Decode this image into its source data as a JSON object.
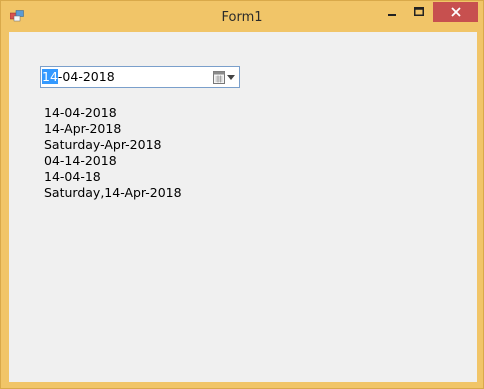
{
  "window": {
    "title": "Form1",
    "controls": {
      "minimize": "minimize-icon",
      "maximize": "maximize-icon",
      "close": "close-icon"
    }
  },
  "datetimepicker": {
    "day": "14",
    "rest": "-04-2018",
    "icon": "calendar-icon"
  },
  "labels": [
    "14-04-2018",
    "14-Apr-2018",
    "Saturday-Apr-2018",
    "04-14-2018",
    "14-04-18",
    "Saturday,14-Apr-2018"
  ],
  "colors": {
    "title_bar": "#f1c568",
    "close_button": "#c7504f",
    "selection": "#3399ff",
    "client_bg": "#f0f0f0"
  }
}
